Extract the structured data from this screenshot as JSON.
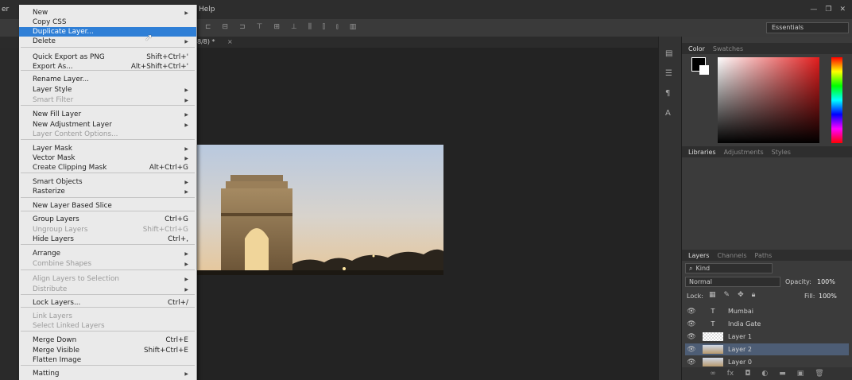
{
  "menubar": {
    "help_label": "Help",
    "partial_left": "er"
  },
  "optionsbar": {
    "workspace": "Essentials"
  },
  "document_tab": {
    "label": "8/8) *",
    "close": "×"
  },
  "menu": {
    "items": [
      {
        "label": "New",
        "shortcut": "",
        "submenu": true,
        "disabled": false,
        "highlighted": false
      },
      {
        "label": "Copy CSS",
        "shortcut": "",
        "submenu": false,
        "disabled": false,
        "highlighted": false
      },
      {
        "label": "Duplicate Layer...",
        "shortcut": "",
        "submenu": false,
        "disabled": false,
        "highlighted": true
      },
      {
        "label": "Delete",
        "shortcut": "",
        "submenu": true,
        "disabled": false,
        "highlighted": false
      },
      {
        "label": "Quick Export as PNG",
        "shortcut": "Shift+Ctrl+'",
        "submenu": false,
        "disabled": false,
        "highlighted": false
      },
      {
        "label": "Export As...",
        "shortcut": "Alt+Shift+Ctrl+'",
        "submenu": false,
        "disabled": false,
        "highlighted": false
      },
      {
        "label": "Rename Layer...",
        "shortcut": "",
        "submenu": false,
        "disabled": false,
        "highlighted": false
      },
      {
        "label": "Layer Style",
        "shortcut": "",
        "submenu": true,
        "disabled": false,
        "highlighted": false
      },
      {
        "label": "Smart Filter",
        "shortcut": "",
        "submenu": true,
        "disabled": true,
        "highlighted": false
      },
      {
        "label": "New Fill Layer",
        "shortcut": "",
        "submenu": true,
        "disabled": false,
        "highlighted": false
      },
      {
        "label": "New Adjustment Layer",
        "shortcut": "",
        "submenu": true,
        "disabled": false,
        "highlighted": false
      },
      {
        "label": "Layer Content Options...",
        "shortcut": "",
        "submenu": false,
        "disabled": true,
        "highlighted": false
      },
      {
        "label": "Layer Mask",
        "shortcut": "",
        "submenu": true,
        "disabled": false,
        "highlighted": false
      },
      {
        "label": "Vector Mask",
        "shortcut": "",
        "submenu": true,
        "disabled": false,
        "highlighted": false
      },
      {
        "label": "Create Clipping Mask",
        "shortcut": "Alt+Ctrl+G",
        "submenu": false,
        "disabled": false,
        "highlighted": false
      },
      {
        "label": "Smart Objects",
        "shortcut": "",
        "submenu": true,
        "disabled": false,
        "highlighted": false
      },
      {
        "label": "Rasterize",
        "shortcut": "",
        "submenu": true,
        "disabled": false,
        "highlighted": false
      },
      {
        "label": "New Layer Based Slice",
        "shortcut": "",
        "submenu": false,
        "disabled": false,
        "highlighted": false
      },
      {
        "label": "Group Layers",
        "shortcut": "Ctrl+G",
        "submenu": false,
        "disabled": false,
        "highlighted": false
      },
      {
        "label": "Ungroup Layers",
        "shortcut": "Shift+Ctrl+G",
        "submenu": false,
        "disabled": true,
        "highlighted": false
      },
      {
        "label": "Hide Layers",
        "shortcut": "Ctrl+,",
        "submenu": false,
        "disabled": false,
        "highlighted": false
      },
      {
        "label": "Arrange",
        "shortcut": "",
        "submenu": true,
        "disabled": false,
        "highlighted": false
      },
      {
        "label": "Combine Shapes",
        "shortcut": "",
        "submenu": true,
        "disabled": true,
        "highlighted": false
      },
      {
        "label": "Align Layers to Selection",
        "shortcut": "",
        "submenu": true,
        "disabled": true,
        "highlighted": false
      },
      {
        "label": "Distribute",
        "shortcut": "",
        "submenu": true,
        "disabled": true,
        "highlighted": false
      },
      {
        "label": "Lock Layers...",
        "shortcut": "Ctrl+/",
        "submenu": false,
        "disabled": false,
        "highlighted": false
      },
      {
        "label": "Link Layers",
        "shortcut": "",
        "submenu": false,
        "disabled": true,
        "highlighted": false
      },
      {
        "label": "Select Linked Layers",
        "shortcut": "",
        "submenu": false,
        "disabled": true,
        "highlighted": false
      },
      {
        "label": "Merge Down",
        "shortcut": "Ctrl+E",
        "submenu": false,
        "disabled": false,
        "highlighted": false
      },
      {
        "label": "Merge Visible",
        "shortcut": "Shift+Ctrl+E",
        "submenu": false,
        "disabled": false,
        "highlighted": false
      },
      {
        "label": "Flatten Image",
        "shortcut": "",
        "submenu": false,
        "disabled": false,
        "highlighted": false
      },
      {
        "label": "Matting",
        "shortcut": "",
        "submenu": true,
        "disabled": false,
        "highlighted": false
      }
    ]
  },
  "color_panel": {
    "tabs": [
      "Color",
      "Swatches"
    ]
  },
  "libraries_panel": {
    "tabs": [
      "Libraries",
      "Adjustments",
      "Styles"
    ]
  },
  "layers_panel": {
    "tabs": [
      "Layers",
      "Channels",
      "Paths"
    ],
    "filter": "Kind",
    "blend_mode": "Normal",
    "opacity_label": "Opacity:",
    "opacity": "100%",
    "lock_label": "Lock:",
    "fill_label": "Fill:",
    "fill": "100%",
    "layers": [
      {
        "name": "Mumbai",
        "kind": "text",
        "selected": false
      },
      {
        "name": "India Gate",
        "kind": "text",
        "selected": false
      },
      {
        "name": "Layer 1",
        "kind": "checker",
        "selected": false
      },
      {
        "name": "Layer 2",
        "kind": "photo",
        "selected": true
      },
      {
        "name": "Layer 0",
        "kind": "photo",
        "selected": false
      }
    ]
  },
  "colors": {
    "highlight": "#2f7fd6",
    "menu_bg": "#eaeaea",
    "panel_bg": "#3b3b3b"
  }
}
